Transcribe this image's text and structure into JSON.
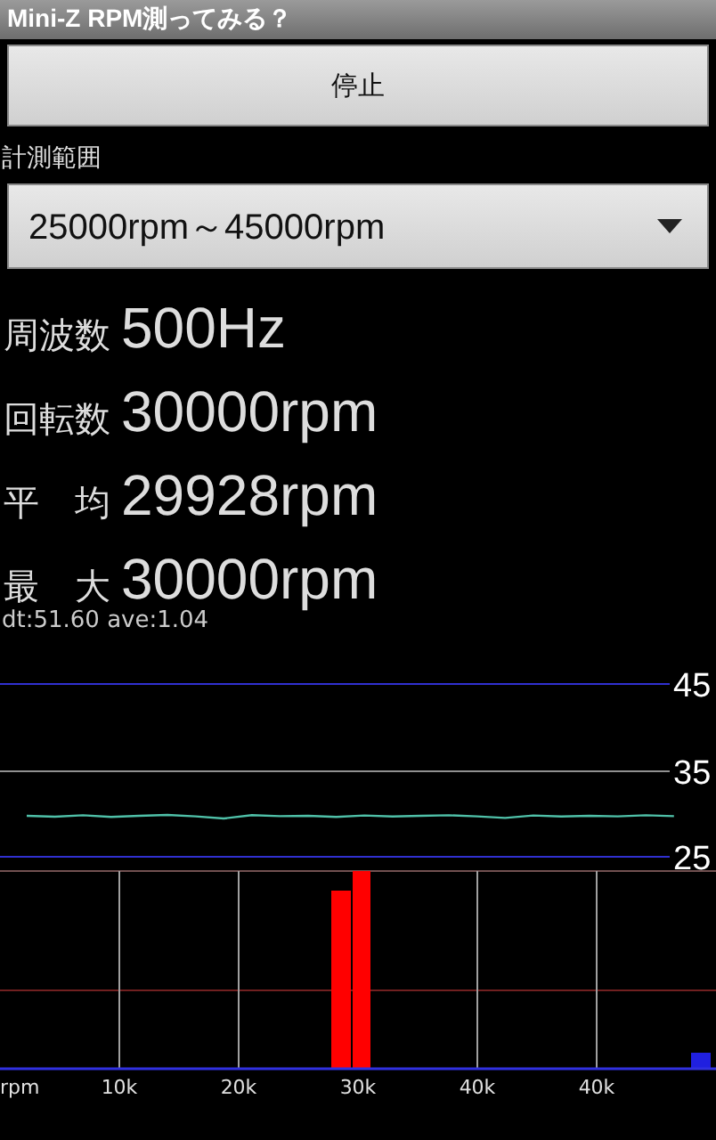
{
  "window": {
    "title": "Mini-Z RPM測ってみる？"
  },
  "stop_button": {
    "label": "停止"
  },
  "range": {
    "label": "計測範囲",
    "value": "25000rpm～45000rpm"
  },
  "readings": [
    {
      "label": "周波数",
      "value": "500Hz"
    },
    {
      "label": "回転数",
      "value": "30000rpm"
    },
    {
      "label": "平　均",
      "value": "29928rpm"
    },
    {
      "label": "最　大",
      "value": "30000rpm"
    }
  ],
  "debug": "dt:51.60 ave:1.04",
  "trend": {
    "labels": [
      "45",
      "35",
      "25"
    ]
  },
  "histogram": {
    "labels": [
      "rpm",
      "10k",
      "20k",
      "30k",
      "40k",
      "40k"
    ]
  }
}
